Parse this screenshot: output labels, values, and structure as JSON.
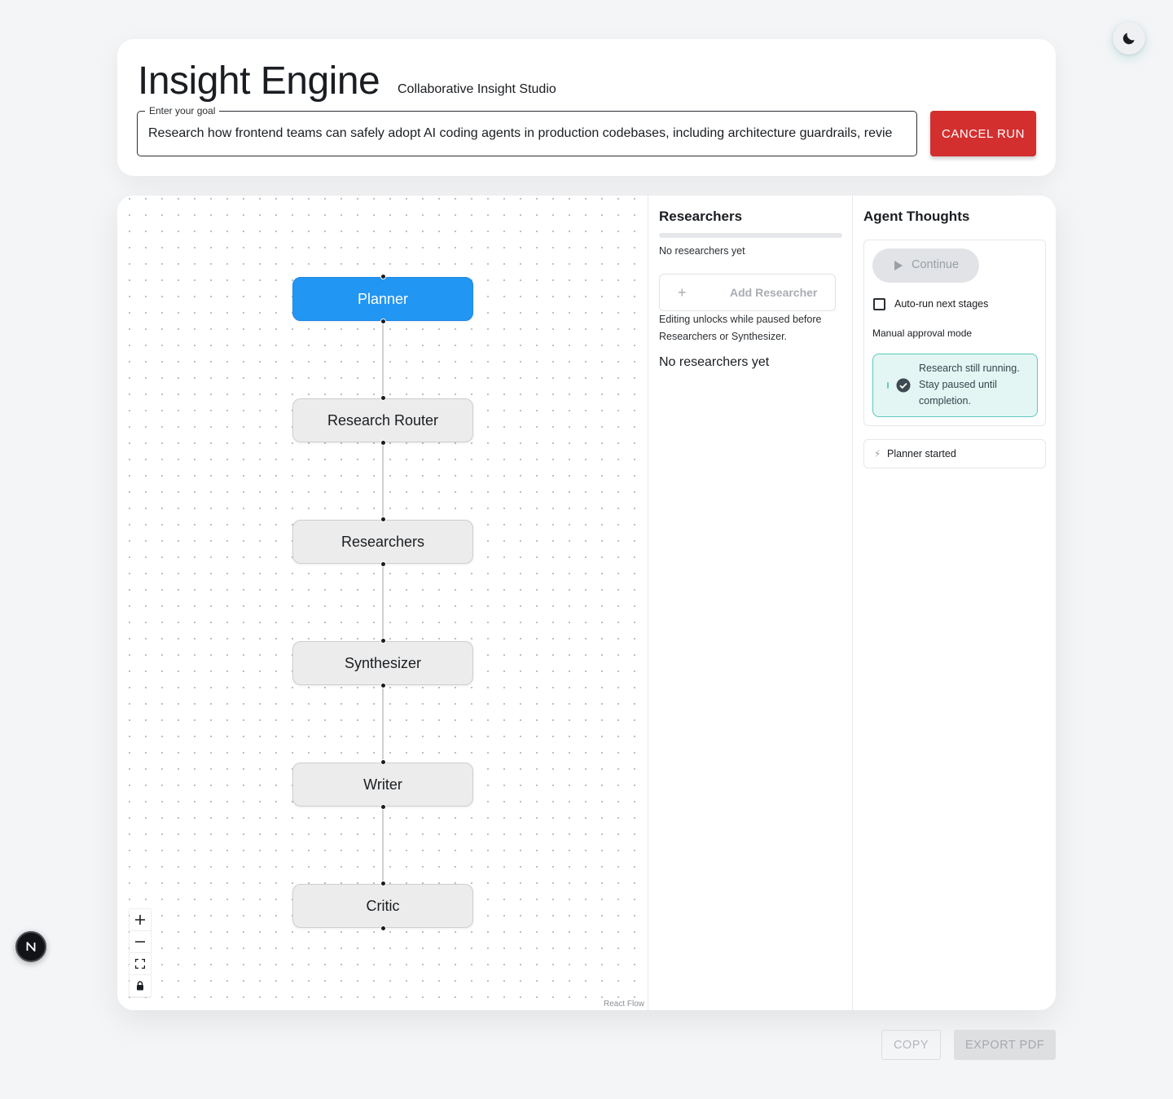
{
  "header": {
    "title": "Insight Engine",
    "subtitle": "Collaborative Insight Studio",
    "goal_label": "Enter your goal",
    "goal_value": "Research how frontend teams can safely adopt AI coding agents in production codebases, including architecture guardrails, revie",
    "cancel_label": "CANCEL RUN"
  },
  "flow": {
    "nodes": [
      {
        "label": "Planner",
        "active": true
      },
      {
        "label": "Research Router",
        "active": false
      },
      {
        "label": "Researchers",
        "active": false
      },
      {
        "label": "Synthesizer",
        "active": false
      },
      {
        "label": "Writer",
        "active": false
      },
      {
        "label": "Critic",
        "active": false
      }
    ],
    "controls": [
      "zoom-in",
      "zoom-out",
      "fit-view",
      "lock"
    ],
    "attribution": "React Flow"
  },
  "researchers": {
    "title": "Researchers",
    "empty_small": "No researchers yet",
    "add_label": "Add Researcher",
    "edit_note": "Editing unlocks while paused before Researchers or Synthesizer.",
    "empty_big": "No researchers yet"
  },
  "thoughts": {
    "title": "Agent Thoughts",
    "continue_label": "Continue",
    "auto_run_label": "Auto-run next stages",
    "mode_text": "Manual approval mode",
    "alert_text": "Research still running. Stay paused until completion.",
    "log": [
      {
        "icon": "lightning-icon",
        "text": "Planner started"
      }
    ]
  },
  "footer": {
    "copy_label": "COPY",
    "export_label": "EXPORT PDF"
  },
  "colors": {
    "active_node": "#2196f3",
    "cancel": "#d32f2f",
    "alert_bg": "#e3f6f4",
    "alert_border": "#5ec8c0"
  },
  "badge": {
    "letter": "N"
  }
}
